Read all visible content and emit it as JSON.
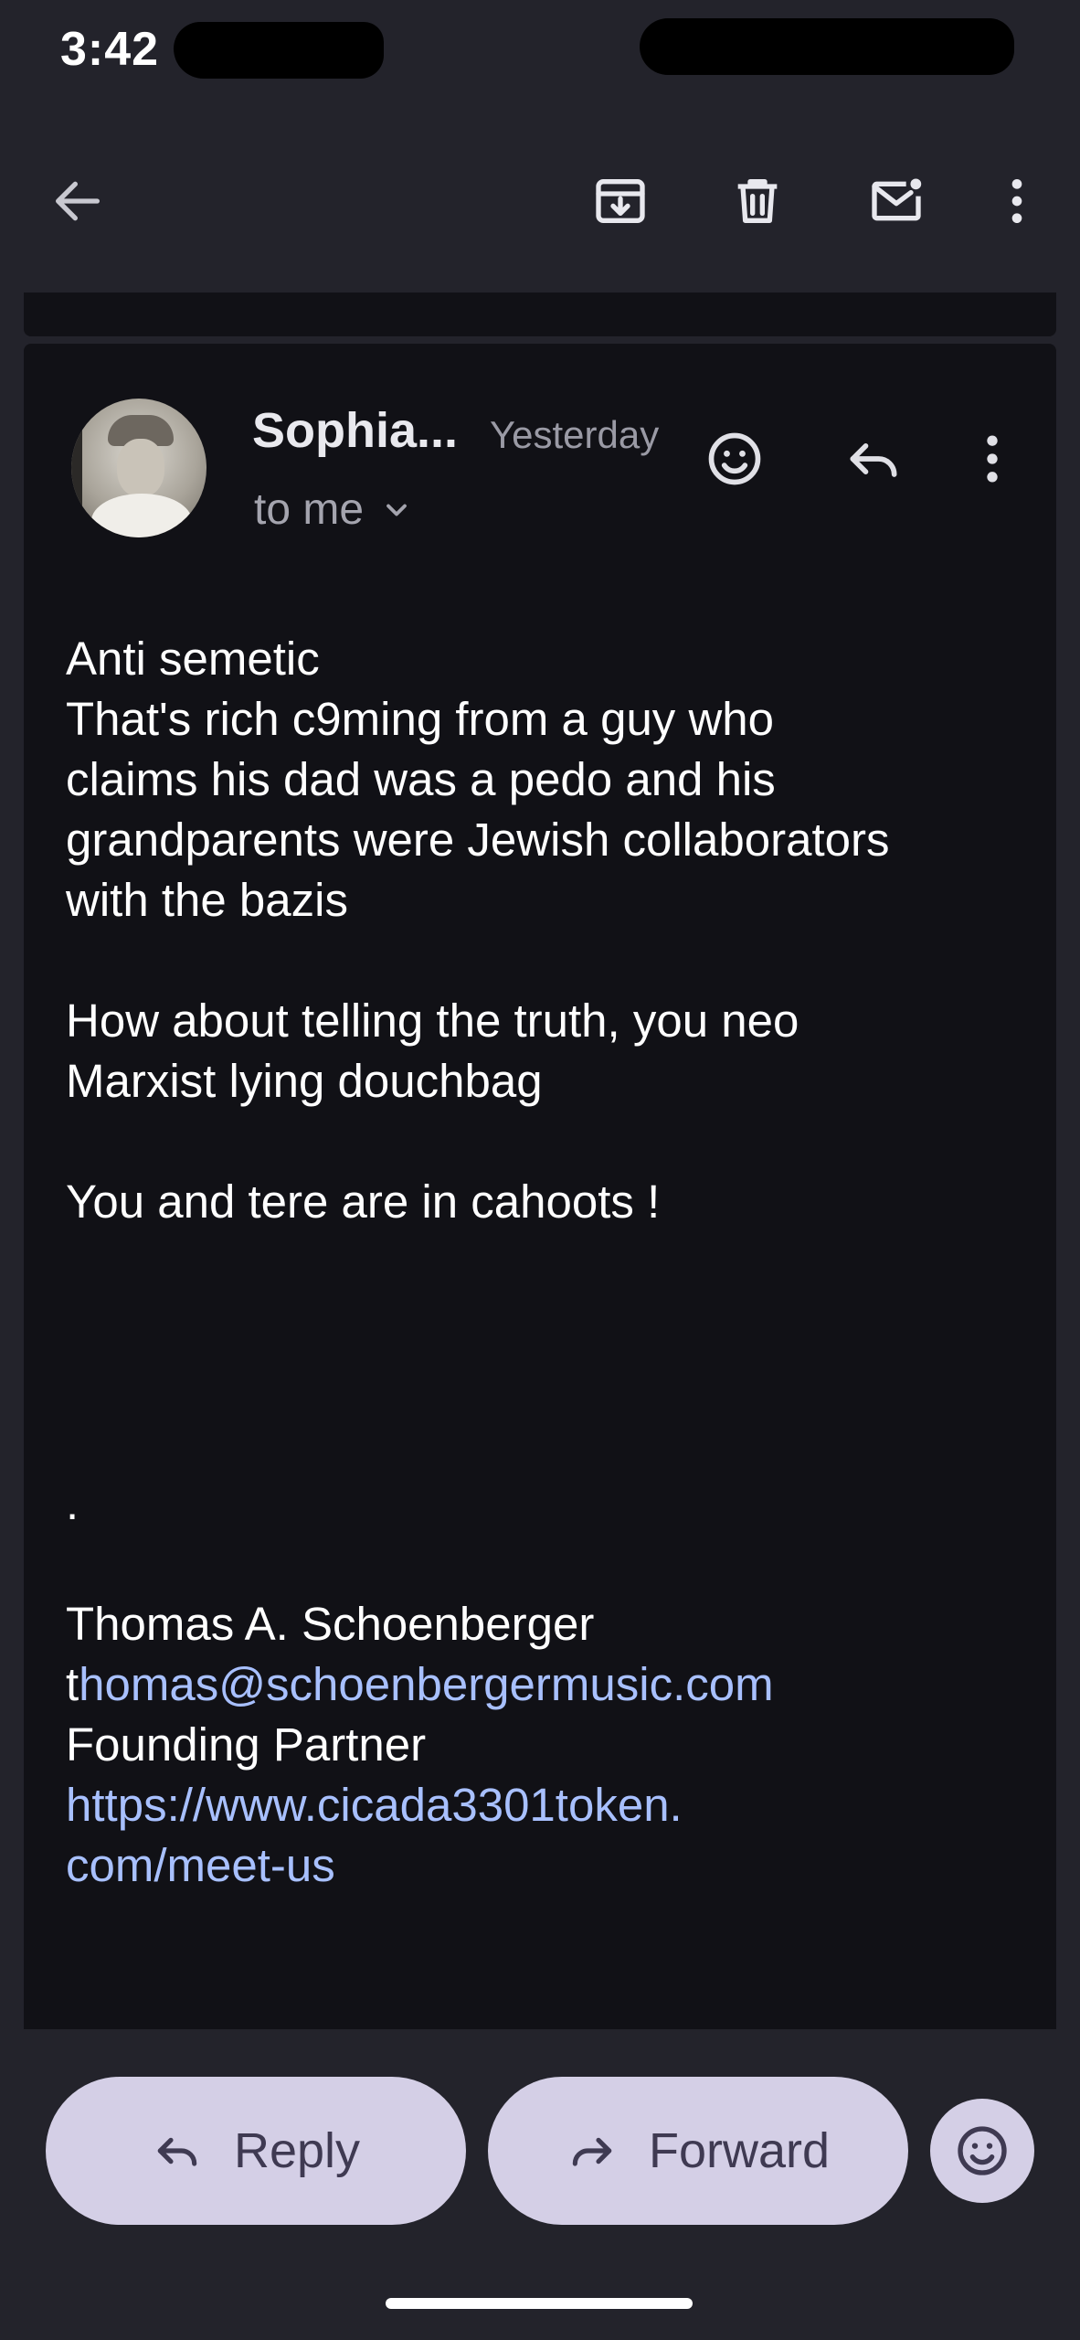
{
  "status_bar": {
    "time": "3:42"
  },
  "toolbar": {
    "back_icon": "arrow-left-icon",
    "archive_icon": "archive-icon",
    "delete_icon": "trash-icon",
    "mark_unread_icon": "mail-unread-icon",
    "more_icon": "more-vert-icon"
  },
  "email": {
    "sender": "Sophia...",
    "time": "Yesterday",
    "recipient": "to me",
    "body_lines": [
      "Anti semetic",
      "That's rich c9ming from a guy who",
      "claims his dad was a pedo and his",
      "grandparents were Jewish collaborators",
      "with the bazis",
      "",
      "How about telling the truth, you neo",
      "Marxist lying douchbag",
      "",
      "You and tere are in cahoots !",
      "",
      "",
      "",
      "",
      ".",
      "",
      "Thomas A. Schoenberger"
    ],
    "signature": {
      "email_prefix": "t",
      "email_link": "homas@schoenbergermusic.com",
      "title": "Founding Partner",
      "url_line1": "https://www.cicada3301token.",
      "url_line2": "com/meet-us"
    }
  },
  "actions": {
    "reply_label": "Reply",
    "forward_label": "Forward"
  },
  "colors": {
    "background": "#23232b",
    "card": "#111116",
    "pill": "#d4cfe6",
    "link": "#a8c0ff"
  }
}
